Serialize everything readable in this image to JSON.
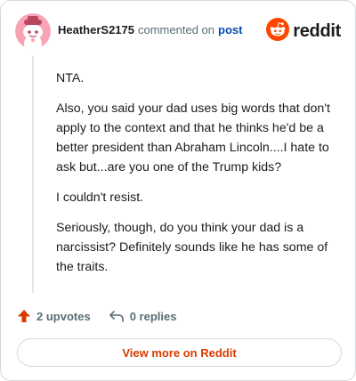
{
  "header": {
    "username": "HeatherS2175",
    "commented_on": "commented on",
    "post_link": "post",
    "logo_text": "reddit"
  },
  "comment": {
    "paragraphs": [
      "NTA.",
      "Also, you said your dad uses big words that don't apply to the context and that he thinks he'd be a better president than Abraham Lincoln....I hate to ask but...are you one of the Trump kids?",
      "I couldn't resist.",
      "Seriously, though, do you think your dad is a narcissist? Definitely sounds like he has some of the traits."
    ]
  },
  "actions": {
    "upvotes": "2 upvotes",
    "replies": "0 replies"
  },
  "footer": {
    "view_more": "View more on Reddit"
  },
  "colors": {
    "accent": "#d93a00",
    "reddit_orange": "#ff4500",
    "link_blue": "#0a4db4",
    "meta_gray": "#576f76",
    "avatar_bg": "#f7a3b4"
  },
  "icons": {
    "avatar": "snoo-avatar-icon",
    "logo": "reddit-logo-icon",
    "upvote": "upvote-arrow-icon",
    "reply": "reply-arrow-icon"
  }
}
